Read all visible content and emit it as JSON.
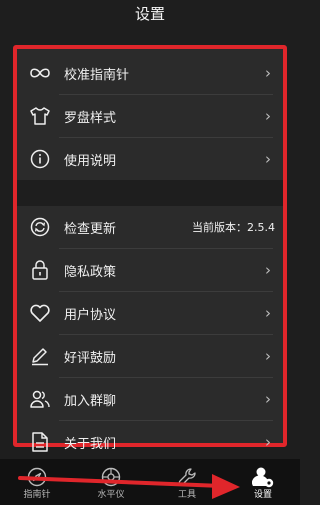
{
  "header": {
    "title": "设置"
  },
  "group1": [
    {
      "label": "校准指南针",
      "icon": "infinity-icon"
    },
    {
      "label": "罗盘样式",
      "icon": "shirt-icon"
    },
    {
      "label": "使用说明",
      "icon": "info-icon"
    }
  ],
  "group2": [
    {
      "label": "检查更新",
      "icon": "refresh-icon",
      "version": "当前版本：2.5.4"
    },
    {
      "label": "隐私政策",
      "icon": "lock-icon"
    },
    {
      "label": "用户协议",
      "icon": "heart-icon"
    },
    {
      "label": "好评鼓励",
      "icon": "pencil-icon"
    },
    {
      "label": "加入群聊",
      "icon": "users-icon"
    },
    {
      "label": "关于我们",
      "icon": "document-icon"
    }
  ],
  "tabs": [
    {
      "label": "指南针",
      "icon": "compass-icon"
    },
    {
      "label": "水平仪",
      "icon": "level-icon"
    },
    {
      "label": "工具",
      "icon": "wrench-icon"
    },
    {
      "label": "设置",
      "icon": "settings-user-icon",
      "active": true
    }
  ],
  "colors": {
    "highlight": "#e0262b",
    "panel": "#2b2b2b",
    "background": "#1e1e1e"
  }
}
